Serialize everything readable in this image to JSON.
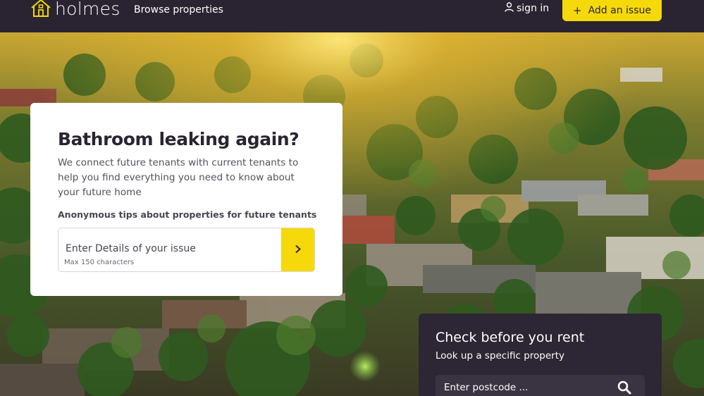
{
  "header": {
    "logo_text": "holmes",
    "nav_browse": "Browse properties",
    "sign_in": "sign in",
    "add_issue_icon": "+",
    "add_issue_label": "Add an issue"
  },
  "hero_card": {
    "title": "Bathroom leaking again?",
    "description": "We connect future tenants with current tenants to help you find everything you need to know about your future home",
    "tips_label": "Anonymous tips about properties for future tenants",
    "issue_placeholder": "Enter Details of your issue",
    "issue_hint": "Max 150 characters"
  },
  "check_panel": {
    "title": "Check before you rent",
    "subtitle": "Look up a specific property",
    "postcode_placeholder": "Enter postcode ..."
  },
  "icons": {
    "logo": "house-icon",
    "sign_in": "user-icon",
    "issue_submit": "chevron-right-icon",
    "postcode_search": "search-icon"
  },
  "colors": {
    "accent": "#f5d90a",
    "header_bg": "#2a2432",
    "panel_bg": "#2d2634"
  }
}
